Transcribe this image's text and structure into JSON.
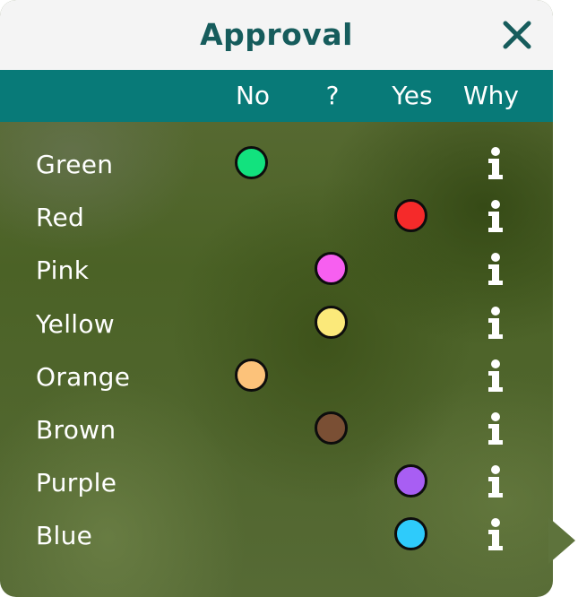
{
  "dialog": {
    "title": "Approval",
    "columns": [
      "No",
      "?",
      "Yes",
      "Why"
    ],
    "rows": [
      {
        "label": "Green",
        "choice": "No",
        "color": "#12e27e"
      },
      {
        "label": "Red",
        "choice": "Yes",
        "color": "#f52a2a"
      },
      {
        "label": "Pink",
        "choice": "?",
        "color": "#f75ff0"
      },
      {
        "label": "Yellow",
        "choice": "?",
        "color": "#fbe97a"
      },
      {
        "label": "Orange",
        "choice": "No",
        "color": "#fcc27a"
      },
      {
        "label": "Brown",
        "choice": "?",
        "color": "#7a4f34"
      },
      {
        "label": "Purple",
        "choice": "Yes",
        "color": "#a85ef3"
      },
      {
        "label": "Blue",
        "choice": "Yes",
        "color": "#2ecbfb"
      }
    ]
  },
  "icons": {
    "close": "close-icon",
    "info": "info-icon"
  },
  "colors": {
    "title_text": "#165c5c",
    "header_bar": "#087a78",
    "title_bar": "#f4f4f4"
  }
}
